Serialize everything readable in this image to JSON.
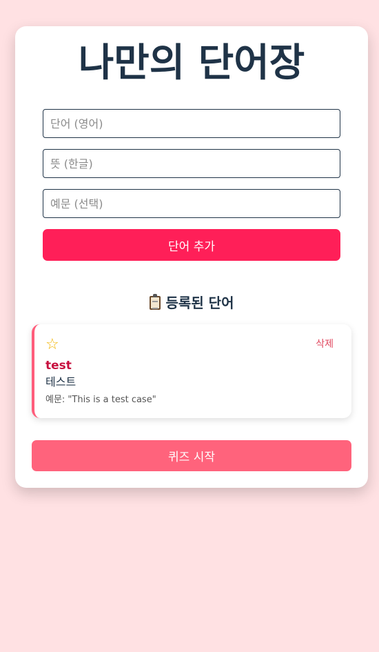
{
  "app": {
    "title": "나만의 단어장"
  },
  "form": {
    "word_placeholder": "단어 (영어)",
    "meaning_placeholder": "뜻 (한글)",
    "example_placeholder": "예문 (선택)",
    "add_label": "단어 추가"
  },
  "list": {
    "heading": "등록된 단어",
    "heading_icon": "clipboard-icon",
    "items": [
      {
        "favorite_icon": "☆",
        "delete_label": "삭제",
        "word": "test",
        "meaning": "테스트",
        "example": "예문: \"This is a test case\""
      }
    ]
  },
  "quiz": {
    "start_label": "퀴즈 시작"
  },
  "colors": {
    "background": "#ffe1e3",
    "primary": "#ff1f58",
    "quiz": "#ff637c",
    "heading": "#1f3347",
    "word": "#c7103f",
    "star": "#f2b400"
  }
}
